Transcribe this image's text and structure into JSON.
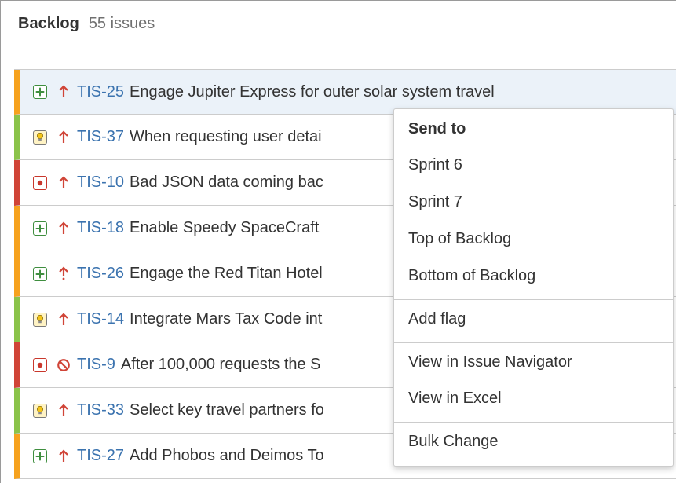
{
  "backlog": {
    "title": "Backlog",
    "issue_count": "55 issues"
  },
  "issues": [
    {
      "key": "TIS-25",
      "summary": "Engage Jupiter Express for outer solar system travel",
      "type": "story",
      "priority": "major",
      "border_color": "#f6a21e"
    },
    {
      "key": "TIS-37",
      "summary": "When requesting user detai",
      "type": "improvement",
      "priority": "major",
      "border_color": "#8bc34a"
    },
    {
      "key": "TIS-10",
      "summary": "Bad JSON data coming bac",
      "type": "bug",
      "priority": "major",
      "border_color": "#d04437"
    },
    {
      "key": "TIS-18",
      "summary": "Enable Speedy SpaceCraft",
      "type": "story",
      "priority": "major",
      "border_color": "#f6a21e"
    },
    {
      "key": "TIS-26",
      "summary": "Engage the Red Titan Hotel",
      "type": "story",
      "priority": "critical",
      "border_color": "#f6a21e"
    },
    {
      "key": "TIS-14",
      "summary": "Integrate Mars Tax Code int",
      "type": "improvement",
      "priority": "major",
      "border_color": "#8bc34a"
    },
    {
      "key": "TIS-9",
      "summary": "After 100,000 requests the S",
      "type": "bug",
      "priority": "blocker",
      "border_color": "#d04437"
    },
    {
      "key": "TIS-33",
      "summary": "Select key travel partners fo",
      "type": "improvement",
      "priority": "major",
      "border_color": "#8bc34a"
    },
    {
      "key": "TIS-27",
      "summary": "Add Phobos and Deimos To",
      "type": "story",
      "priority": "major",
      "border_color": "#f6a21e"
    }
  ],
  "context_menu": {
    "heading": "Send to",
    "sprint_6": "Sprint 6",
    "sprint_7": "Sprint 7",
    "top_of_backlog": "Top of Backlog",
    "bottom_of_backlog": "Bottom of Backlog",
    "add_flag": "Add flag",
    "view_in_issue_navigator": "View in Issue Navigator",
    "view_in_excel": "View in Excel",
    "bulk_change": "Bulk Change"
  },
  "colors": {
    "link": "#3b73af",
    "priority_arrow": "#d04437",
    "selected_row": "#ebf2f9"
  }
}
